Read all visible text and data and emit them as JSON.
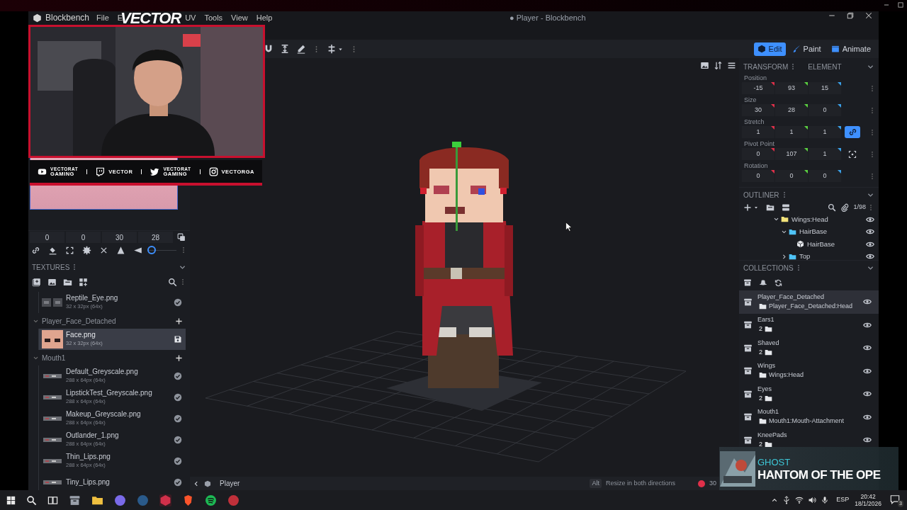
{
  "menu": {
    "app": "Blockbench",
    "items": [
      "File",
      "E",
      "UV",
      "Tools",
      "View",
      "Help"
    ]
  },
  "window_title": "● Player - Blockbench",
  "stream_overlay": {
    "logo": "VECTOR",
    "socials": [
      {
        "kind": "youtube",
        "lines": [
          "VECTORAT",
          "GAMING"
        ]
      },
      {
        "kind": "twitch",
        "lines": [
          "VECTOR"
        ]
      },
      {
        "kind": "twitter",
        "lines": [
          "VECTORAT",
          "GAMING"
        ]
      },
      {
        "kind": "instagram",
        "lines": [
          "VECTORGA"
        ]
      }
    ]
  },
  "modes": [
    {
      "label": "Edit",
      "selected": true
    },
    {
      "label": "Paint",
      "selected": false
    },
    {
      "label": "Animate",
      "selected": false
    }
  ],
  "uv_values": [
    "0",
    "0",
    "30",
    "28"
  ],
  "uv_zoom": {
    "level": 0
  },
  "textures": {
    "title": "TEXTURES",
    "entries": [
      {
        "kind": "texture",
        "name": "Reptile_Eye.png",
        "size": "32 x 32px (64x)",
        "selected": false,
        "unsaved": false
      },
      {
        "kind": "group",
        "name": "Player_Face_Detached",
        "expanded": true
      },
      {
        "kind": "texture",
        "name": "Face.png",
        "size": "32 x 32px (64x)",
        "selected": true,
        "unsaved": true
      },
      {
        "kind": "group",
        "name": "Mouth1",
        "expanded": true
      },
      {
        "kind": "texture",
        "name": "Default_Greyscale.png",
        "size": "288 x 64px (64x)",
        "selected": false,
        "unsaved": false
      },
      {
        "kind": "texture",
        "name": "LipstickTest_Greyscale.png",
        "size": "288 x 64px (64x)",
        "selected": false,
        "unsaved": false
      },
      {
        "kind": "texture",
        "name": "Makeup_Greyscale.png",
        "size": "288 x 64px (64x)",
        "selected": false,
        "unsaved": false
      },
      {
        "kind": "texture",
        "name": "Outlander_1.png",
        "size": "288 x 64px (64x)",
        "selected": false,
        "unsaved": false
      },
      {
        "kind": "texture",
        "name": "Thin_Lips.png",
        "size": "288 x 64px (64x)",
        "selected": false,
        "unsaved": false
      },
      {
        "kind": "texture",
        "name": "Tiny_Lips.png",
        "selected": false,
        "unsaved": false
      }
    ]
  },
  "transform": {
    "title": "TRANSFORM",
    "tab": "ELEMENT",
    "rows": [
      {
        "kind": "vector",
        "label": "Position",
        "values": [
          "-15",
          "93",
          "15"
        ]
      },
      {
        "kind": "vector",
        "label": "Size",
        "values": [
          "30",
          "28",
          "0"
        ]
      },
      {
        "kind": "linkable",
        "label": "Stretch",
        "values": [
          "1",
          "1",
          "1"
        ],
        "linked": true
      },
      {
        "kind": "pivot",
        "label": "Pivot Point",
        "values": [
          "0",
          "107",
          "1"
        ]
      },
      {
        "kind": "vector",
        "label": "Rotation",
        "values": [
          "0",
          "0",
          "0"
        ]
      }
    ]
  },
  "outliner": {
    "title": "OUTLINER",
    "count": "1/98",
    "tree": [
      {
        "kind": "group",
        "name": "Wings:Head",
        "color": "#f2e27a",
        "expanded": true,
        "visible": true,
        "children": [
          {
            "kind": "group",
            "name": "HairBase",
            "color": "#4fc3f7",
            "expanded": true,
            "visible": true,
            "children": [
              {
                "kind": "cube",
                "name": "HairBase",
                "visible": true
              }
            ]
          },
          {
            "kind": "group",
            "name": "Top",
            "color": "#4fc3f7",
            "expanded": false,
            "visible": true
          }
        ]
      }
    ]
  },
  "collections": {
    "title": "COLLECTIONS",
    "items": [
      {
        "kind": "group",
        "name": "Player_Face_Detached",
        "content": "Player_Face_Detached:Head",
        "selected": true,
        "visible": true
      },
      {
        "kind": "count",
        "name": "Ears1",
        "content": "2",
        "selected": false,
        "visible": true
      },
      {
        "kind": "count",
        "name": "Shaved",
        "content": "2",
        "selected": false,
        "visible": true
      },
      {
        "kind": "group",
        "name": "Wings",
        "content": "Wings:Head",
        "selected": false,
        "visible": true
      },
      {
        "kind": "count",
        "name": "Eyes",
        "content": "2",
        "selected": false,
        "visible": true
      },
      {
        "kind": "group",
        "name": "Mouth1",
        "content": "Mouth1:Mouth-Attachment",
        "selected": false,
        "visible": true
      },
      {
        "kind": "count",
        "name": "KneePads",
        "content": "2",
        "selected": false,
        "visible": true
      }
    ]
  },
  "status_bar": {
    "breadcrumb": "Player",
    "key": "Alt",
    "hint": "Resize in both directions",
    "fps": "30"
  },
  "now_playing": {
    "artist": "GHOST",
    "title": "HANTOM OF THE OPE"
  },
  "taskbar": {
    "language": "ESP",
    "time": "20:42",
    "date": "18/1/2026",
    "notifications": "3"
  }
}
